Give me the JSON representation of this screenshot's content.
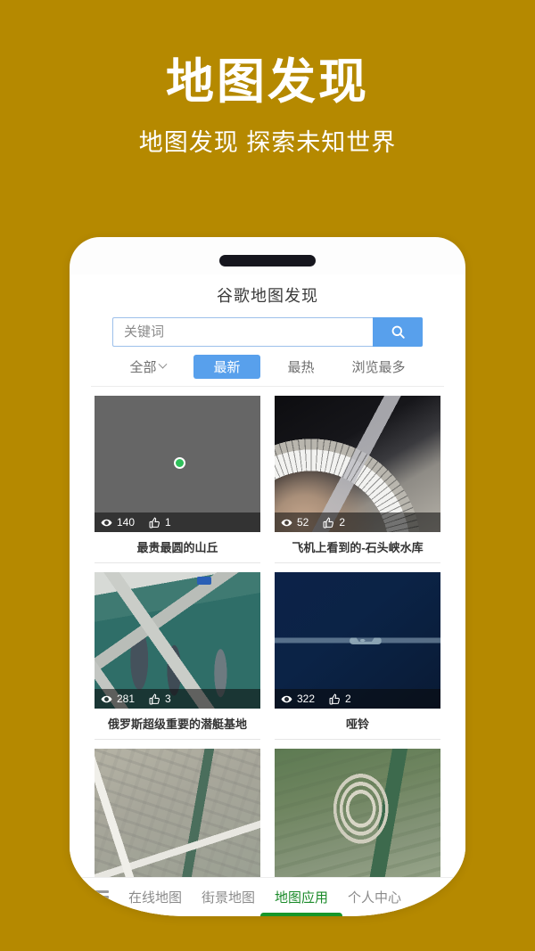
{
  "promo": {
    "title": "地图发现",
    "subtitle": "地图发现 探索未知世界"
  },
  "app": {
    "title": "谷歌地图发现"
  },
  "search": {
    "placeholder": "关键词",
    "value": "",
    "button_icon": "search-icon"
  },
  "filters": [
    {
      "label": "全部",
      "active": false,
      "has_caret": true
    },
    {
      "label": "最新",
      "active": true,
      "has_caret": false
    },
    {
      "label": "最热",
      "active": false,
      "has_caret": false
    },
    {
      "label": "浏览最多",
      "active": false,
      "has_caret": false
    }
  ],
  "cards": [
    {
      "caption": "最贵最圆的山丘",
      "views": "140",
      "likes": "1",
      "art": "art-hills"
    },
    {
      "caption": "飞机上看到的-石头峡水库",
      "views": "52",
      "likes": "2",
      "art": "art-dam"
    },
    {
      "caption": "俄罗斯超级重要的潜艇基地",
      "views": "281",
      "likes": "3",
      "art": "art-harbor"
    },
    {
      "caption": "哑铃",
      "views": "322",
      "likes": "2",
      "art": "art-ocean"
    },
    {
      "caption": "",
      "views": "",
      "likes": "",
      "art": "art-city"
    },
    {
      "caption": "",
      "views": "",
      "likes": "",
      "art": "art-racetrack"
    }
  ],
  "bottom_nav": {
    "menu_icon": "hamburger-icon",
    "items": [
      {
        "label": "在线地图",
        "active": false
      },
      {
        "label": "街景地图",
        "active": false
      },
      {
        "label": "地图应用",
        "active": true
      },
      {
        "label": "个人中心",
        "active": false
      }
    ]
  },
  "colors": {
    "background": "#b58900",
    "accent_blue": "#58a0ec",
    "accent_green": "#17962a",
    "phone_body": "#ffffff",
    "text_primary": "#343434",
    "text_muted": "#8b8b8b"
  }
}
